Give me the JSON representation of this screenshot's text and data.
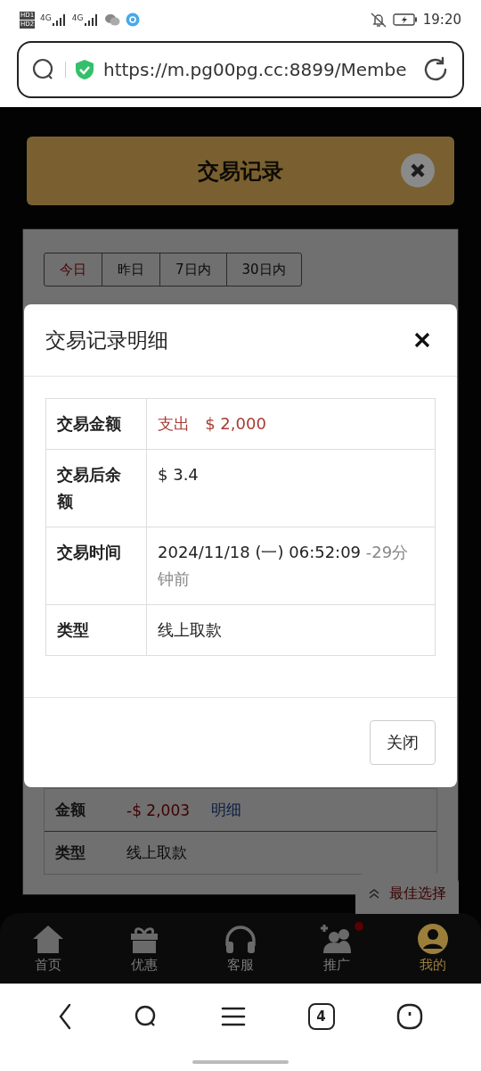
{
  "status_bar": {
    "time": "19:20",
    "sim_labels": [
      "HD1",
      "HD2"
    ],
    "network_labels": [
      "4G",
      "4G"
    ]
  },
  "address_bar": {
    "url": "https://m.pg00pg.cc:8899/Membe"
  },
  "page": {
    "title": "交易记录",
    "date_tabs": [
      {
        "label": "今日",
        "selected": true
      },
      {
        "label": "昨日",
        "selected": false
      },
      {
        "label": "7日内",
        "selected": false
      },
      {
        "label": "30日内",
        "selected": false
      }
    ],
    "record_rows": [
      {
        "label": "金额",
        "value": "-$ 2,003",
        "link": "明细"
      },
      {
        "label": "类型",
        "value": "线上取款"
      }
    ],
    "float_button": "最佳选择"
  },
  "modal": {
    "title": "交易记录明细",
    "rows": [
      {
        "label": "交易金额",
        "parts": [
          {
            "text": "支出",
            "kind": "expense"
          },
          {
            "text": "$ 2,000",
            "kind": "expense"
          }
        ]
      },
      {
        "label": "交易后余额",
        "parts": [
          {
            "text": "$ 3.4",
            "kind": "plain"
          }
        ]
      },
      {
        "label": "交易时间",
        "parts": [
          {
            "text": "2024/11/18 (一) 06:52:09",
            "kind": "plain"
          },
          {
            "text": "-29分钟前",
            "kind": "muted"
          }
        ]
      },
      {
        "label": "类型",
        "parts": [
          {
            "text": "线上取款",
            "kind": "plain"
          }
        ]
      }
    ],
    "button": "关闭"
  },
  "bottom_nav": [
    {
      "label": "首页",
      "kind": "home",
      "selected": false,
      "badge": false
    },
    {
      "label": "优惠",
      "kind": "gift",
      "selected": false,
      "badge": false
    },
    {
      "label": "客服",
      "kind": "headset",
      "selected": false,
      "badge": false
    },
    {
      "label": "推广",
      "kind": "people",
      "selected": false,
      "badge": true
    },
    {
      "label": "我的",
      "kind": "user",
      "selected": true,
      "badge": false
    }
  ],
  "browser_toolbar": {
    "tab_count": "4"
  }
}
